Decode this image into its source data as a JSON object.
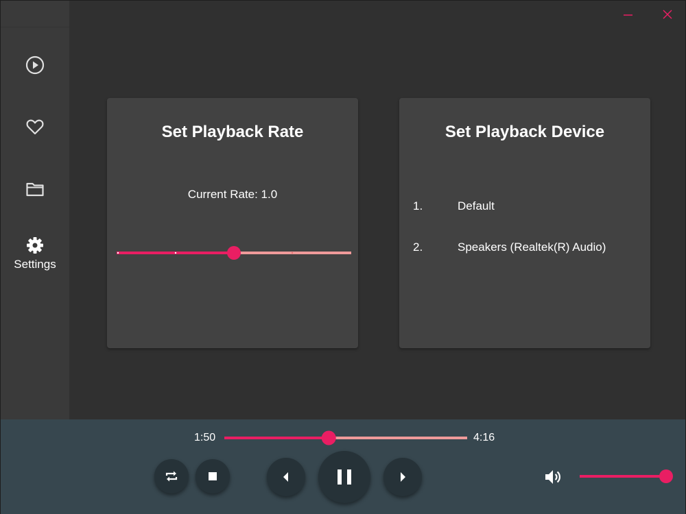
{
  "window": {
    "minimize_icon": "minimize-icon",
    "close_icon": "close-icon",
    "accent_color": "#e91e63"
  },
  "sidebar": {
    "items": [
      {
        "id": "now-playing",
        "icon": "play-circle-icon",
        "label": ""
      },
      {
        "id": "favorites",
        "icon": "heart-icon",
        "label": ""
      },
      {
        "id": "library",
        "icon": "folder-icon",
        "label": ""
      },
      {
        "id": "settings",
        "icon": "gear-icon",
        "label": "Settings",
        "active": true
      }
    ]
  },
  "playback_rate": {
    "title": "Set Playback Rate",
    "current_label": "Current Rate: 1.0",
    "slider_value_fraction": 0.5
  },
  "playback_device": {
    "title": "Set Playback Device",
    "devices": [
      {
        "number": "1.",
        "name": "Default"
      },
      {
        "number": "2.",
        "name": "Speakers (Realtek(R) Audio)"
      }
    ]
  },
  "player": {
    "current_time": "1:50",
    "total_time": "4:16",
    "seek_fraction": 0.43,
    "volume_fraction": 1.0,
    "controls": {
      "repeat_icon": "repeat-icon",
      "stop_icon": "stop-icon",
      "previous_icon": "previous-icon",
      "pause_icon": "pause-icon",
      "next_icon": "next-icon",
      "volume_icon": "volume-icon"
    }
  },
  "colors": {
    "background": "#303030",
    "sidebar": "#3a3a3a",
    "card": "#424242",
    "player_bar": "#37474f",
    "button": "#263238",
    "accent": "#e91e63",
    "track_light": "#ef9a9a"
  }
}
